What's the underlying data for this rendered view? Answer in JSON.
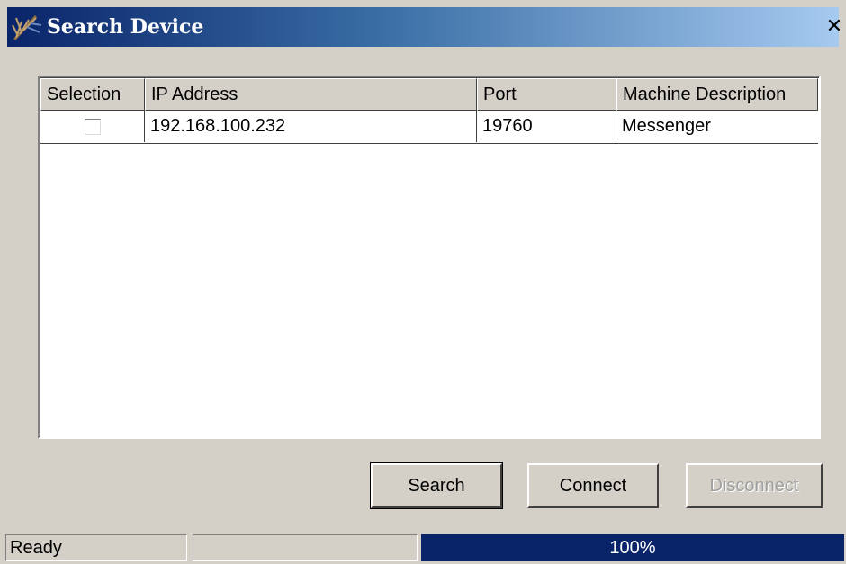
{
  "window": {
    "title": "Search Device",
    "close_glyph": "✕",
    "icon": "app-feather-icon"
  },
  "table": {
    "columns": [
      "Selection",
      "IP Address",
      "Port",
      "Machine Description"
    ],
    "rows": [
      {
        "selected": false,
        "ip": "192.168.100.232",
        "port": "19760",
        "description": "Messenger"
      }
    ]
  },
  "buttons": {
    "search": "Search",
    "connect": "Connect",
    "disconnect": "Disconnect",
    "disconnect_enabled": false
  },
  "status": {
    "text": "Ready",
    "progress_label": "100%",
    "progress_value": 100
  },
  "colors": {
    "titlebar_start": "#0a246a",
    "titlebar_end": "#a6caf0",
    "face": "#d4d0c8",
    "progress": "#0a246a"
  }
}
